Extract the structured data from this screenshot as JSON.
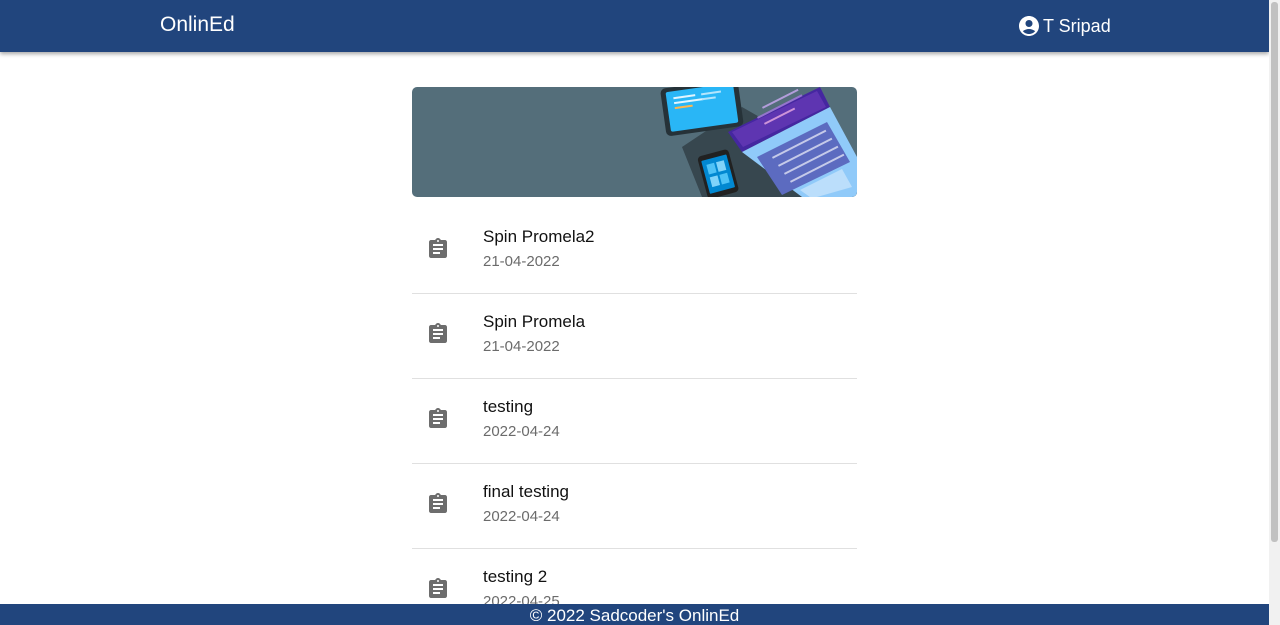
{
  "appbar": {
    "brand": "OnlinEd",
    "user_name": "T Sripad",
    "user_icon": "account-circle-icon",
    "color": "#21457d"
  },
  "banner": {
    "background": "#546e7a"
  },
  "assignments": [
    {
      "title": "Spin Promela2",
      "date": "21-04-2022",
      "icon": "assignment-icon"
    },
    {
      "title": "Spin Promela",
      "date": "21-04-2022",
      "icon": "assignment-icon"
    },
    {
      "title": "testing",
      "date": "2022-04-24",
      "icon": "assignment-icon"
    },
    {
      "title": "final testing",
      "date": "2022-04-24",
      "icon": "assignment-icon"
    },
    {
      "title": "testing 2",
      "date": "2022-04-25",
      "icon": "assignment-icon"
    }
  ],
  "footer": {
    "text": "© 2022 Sadcoder's OnlinEd"
  }
}
